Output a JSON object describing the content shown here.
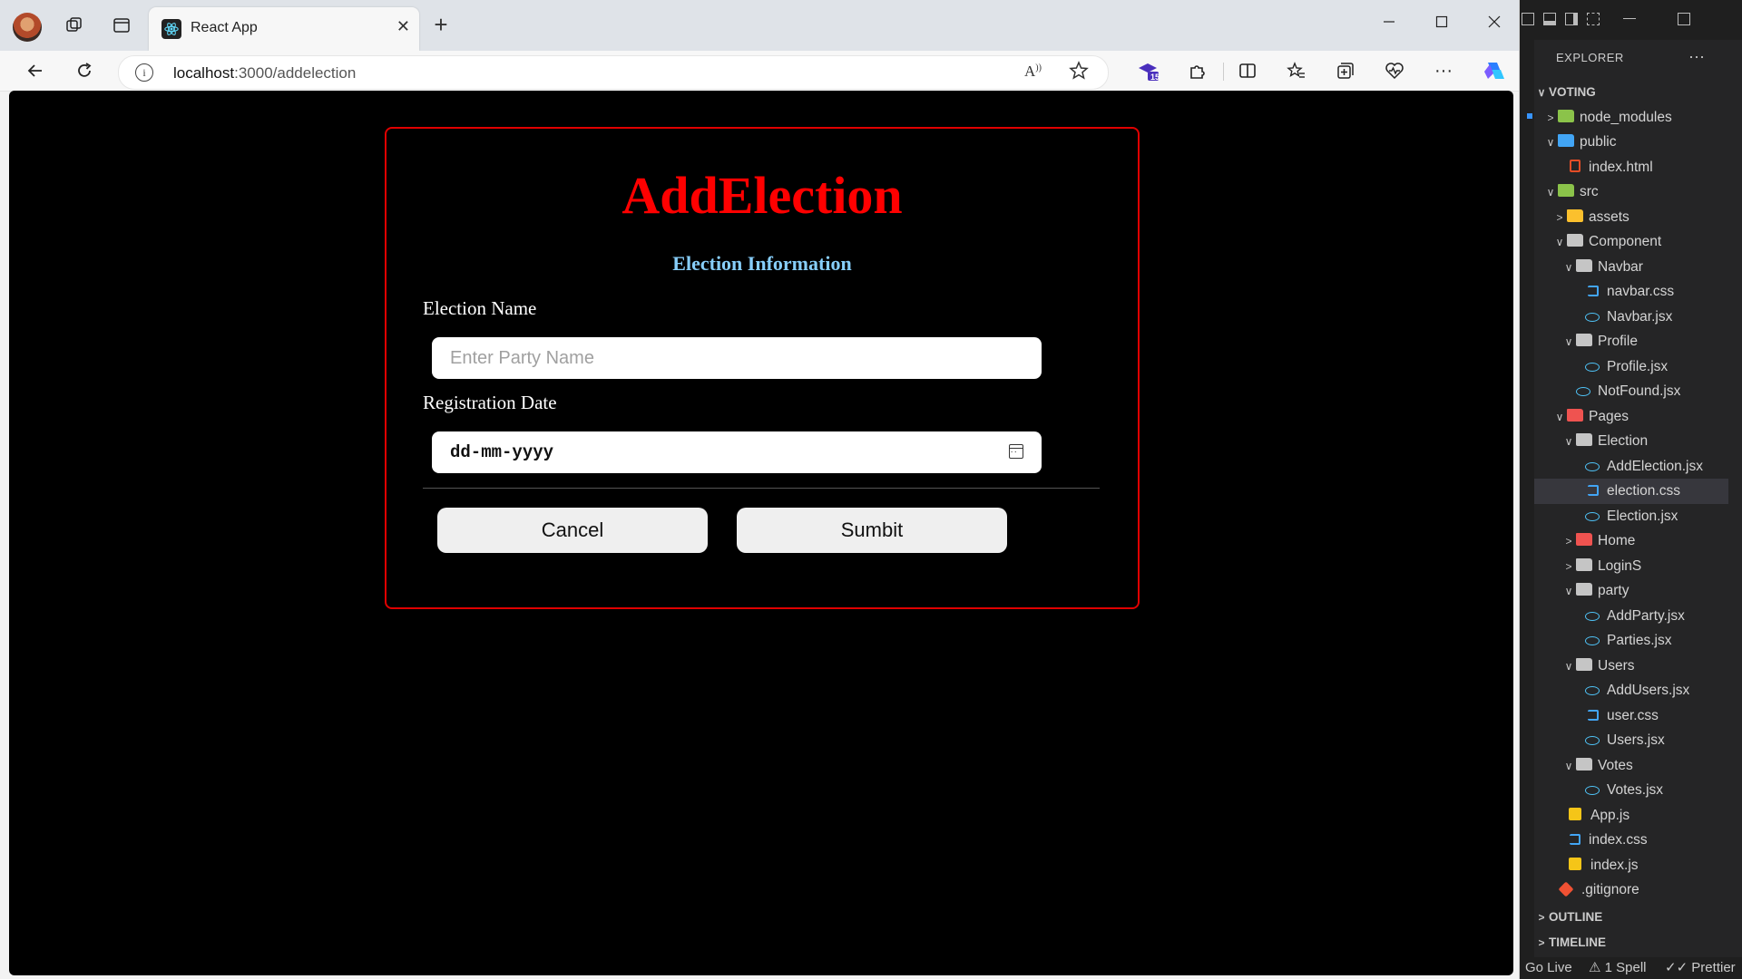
{
  "browser": {
    "tab_title": "React App",
    "url_host": "localhost",
    "url_path": ":3000/addelection",
    "tab_close": "✕",
    "new_tab": "+",
    "toolbar_badge": "15"
  },
  "page": {
    "title": "AddElection",
    "section_title": "Election Information",
    "election_name_label": "Election Name",
    "election_name_placeholder": "Enter Party Name",
    "registration_date_label": "Registration Date",
    "registration_date_value": "dd-mm-yyyy",
    "cancel_label": "Cancel",
    "submit_label": "Sumbit",
    "colors": {
      "title": "#ff0000",
      "section_title": "#87cefa",
      "card_border": "#e00000",
      "background": "#000000"
    }
  },
  "vscode": {
    "explorer_title": "EXPLORER",
    "more": "···",
    "tree": [
      {
        "label": "VOTING",
        "type": "section",
        "chevron": "∨"
      },
      {
        "label": "node_modules",
        "type": "folder-green",
        "chevron": ">"
      },
      {
        "label": "public",
        "type": "folder-blue",
        "chevron": "∨"
      },
      {
        "label": "index.html",
        "type": "html"
      },
      {
        "label": "src",
        "type": "folder-green",
        "chevron": "∨"
      },
      {
        "label": "assets",
        "type": "folder-yellow",
        "chevron": ">"
      },
      {
        "label": "Component",
        "type": "folder",
        "chevron": "∨"
      },
      {
        "label": "Navbar",
        "type": "folder",
        "chevron": "∨"
      },
      {
        "label": "navbar.css",
        "type": "css"
      },
      {
        "label": "Navbar.jsx",
        "type": "react"
      },
      {
        "label": "Profile",
        "type": "folder",
        "chevron": "∨"
      },
      {
        "label": "Profile.jsx",
        "type": "react"
      },
      {
        "label": "NotFound.jsx",
        "type": "react"
      },
      {
        "label": "Pages",
        "type": "folder-red",
        "chevron": "∨"
      },
      {
        "label": "Election",
        "type": "folder",
        "chevron": "∨"
      },
      {
        "label": "AddElection.jsx",
        "type": "react"
      },
      {
        "label": "election.css",
        "type": "css",
        "selected": true
      },
      {
        "label": "Election.jsx",
        "type": "react"
      },
      {
        "label": "Home",
        "type": "folder-red",
        "chevron": ">"
      },
      {
        "label": "LoginS",
        "type": "folder",
        "chevron": ">"
      },
      {
        "label": "party",
        "type": "folder",
        "chevron": "∨"
      },
      {
        "label": "AddParty.jsx",
        "type": "react"
      },
      {
        "label": "Parties.jsx",
        "type": "react"
      },
      {
        "label": "Users",
        "type": "folder",
        "chevron": "∨"
      },
      {
        "label": "AddUsers.jsx",
        "type": "react"
      },
      {
        "label": "user.css",
        "type": "css"
      },
      {
        "label": "Users.jsx",
        "type": "react"
      },
      {
        "label": "Votes",
        "type": "folder",
        "chevron": "∨"
      },
      {
        "label": "Votes.jsx",
        "type": "react"
      },
      {
        "label": "App.js",
        "type": "js"
      },
      {
        "label": "index.css",
        "type": "css"
      },
      {
        "label": "index.js",
        "type": "js"
      },
      {
        "label": ".gitignore",
        "type": "git"
      }
    ],
    "outline": "OUTLINE",
    "timeline": "TIMELINE",
    "status_go_live": "Go Live",
    "status_spell": "⚠ 1 Spell",
    "status_prettier": "✓✓ Prettier"
  }
}
